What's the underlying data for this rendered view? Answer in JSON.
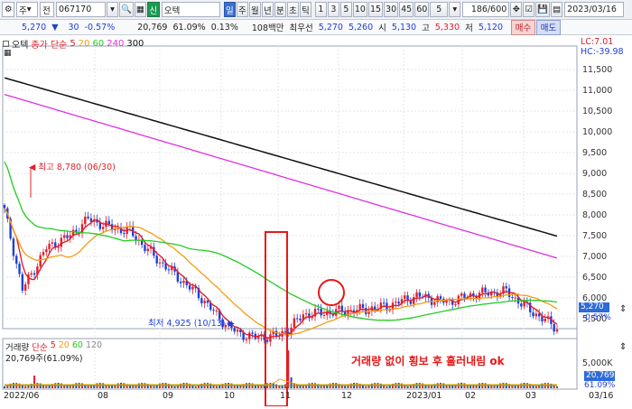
{
  "toolbar": {
    "type_label": "주",
    "period_label": "전",
    "stock_code": "067170",
    "stock_name": "오텍",
    "badge": "신",
    "period_buttons": [
      "일",
      "주",
      "월",
      "년",
      "분",
      "초",
      "틱"
    ],
    "minute_buttons": [
      "1",
      "3",
      "5",
      "10",
      "15",
      "30",
      "45",
      "60",
      "5"
    ],
    "count": "186",
    "count_total": "/600",
    "date": "2023/03/16"
  },
  "quote": {
    "price": "5,270",
    "change": "30",
    "change_pct": "-0.57%",
    "volume": "20,769",
    "vol_ratio": "61.09%",
    "turnover": "0.13%",
    "amount": "108백만",
    "best_label": "최우선",
    "ask": "5,270",
    "bid": "5,260",
    "open_label": "시",
    "open": "5,130",
    "high_label": "고",
    "high": "5,330",
    "low_label": "저",
    "low": "5,120",
    "buy_label": "매수",
    "sell_label": "매도"
  },
  "chart": {
    "stock": "오텍",
    "ma_title": "종가 단순",
    "ma_periods": [
      "5",
      "20",
      "60",
      "240",
      "300"
    ],
    "lc": "LC:7.01",
    "hc": "HC:-39.98",
    "max_label": "최고 8,780 (06/30)",
    "min_label": "최저 4,925 (10/13)",
    "annotation": "거래량 없이 횡보 후 흘러내림 ok",
    "price_tag": "5,270",
    "pct_tag": "-0.57%",
    "vol_title": "거래량",
    "vol_ma_title": "단순",
    "vol_ma_periods": [
      "5",
      "20",
      "60",
      "120"
    ],
    "vol_info": "20,769주(61.09%)",
    "vol_axis": [
      "5,000K",
      "20,769",
      "61.09%"
    ],
    "x_labels": [
      "2022/06",
      "08",
      "09",
      "10",
      "11",
      "12",
      "2023/01",
      "02",
      "03",
      "03/16"
    ],
    "y_ticks": [
      "11,500",
      "11,000",
      "10,500",
      "10,000",
      "9,500",
      "9,000",
      "8,500",
      "8,000",
      "7,500",
      "7,000",
      "6,500",
      "6,000",
      "5,500",
      "5,000"
    ]
  },
  "colors": {
    "up": "#e0202c",
    "down": "#1f3fd8",
    "ma5": "#e0202c",
    "ma20": "#f39c12",
    "ma60": "#22cc22",
    "ma240": "#e030e0",
    "ma300": "#111111",
    "annotation": "#e81818"
  }
}
